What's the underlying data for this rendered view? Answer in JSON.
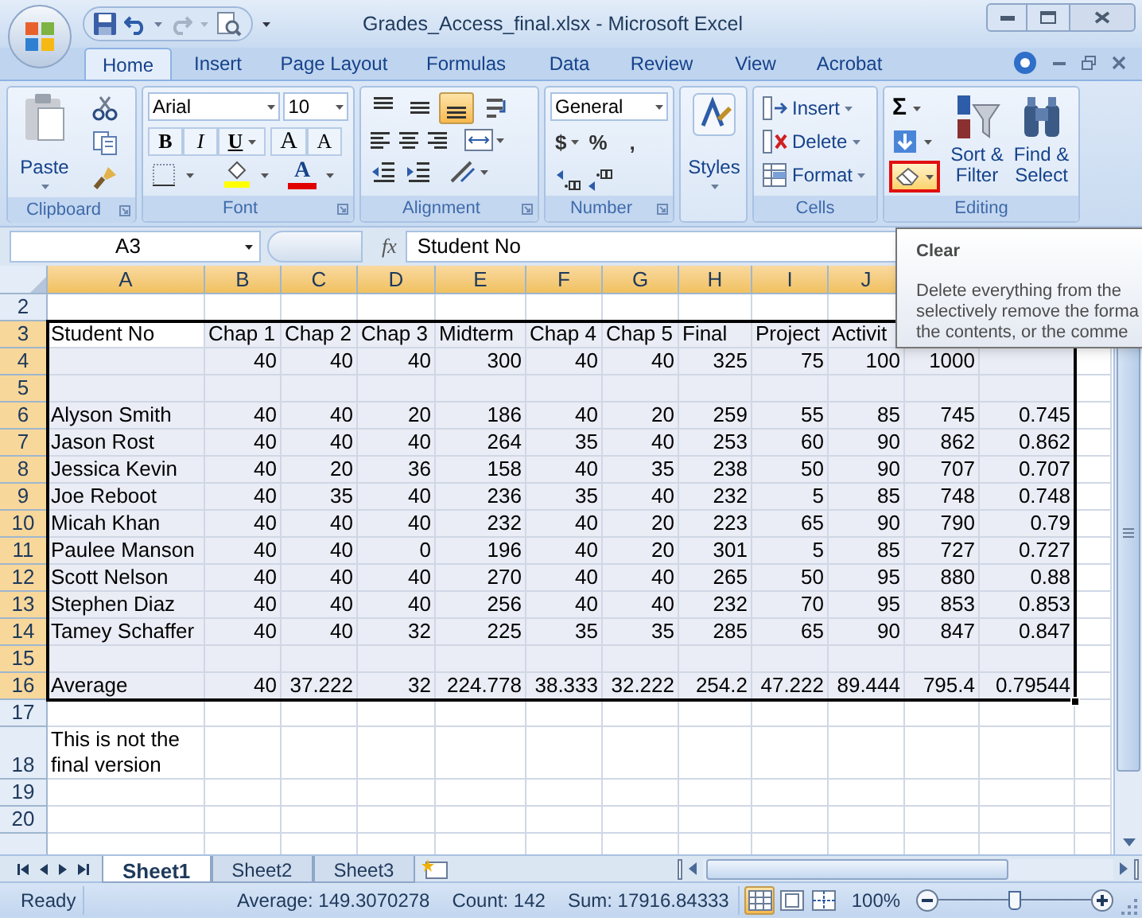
{
  "title_bar": {
    "title": "Grades_Access_final.xlsx - Microsoft Excel"
  },
  "tabs": [
    {
      "label": "Home",
      "selected": true
    },
    {
      "label": "Insert",
      "selected": false
    },
    {
      "label": "Page Layout",
      "selected": false
    },
    {
      "label": "Formulas",
      "selected": false
    },
    {
      "label": "Data",
      "selected": false
    },
    {
      "label": "Review",
      "selected": false
    },
    {
      "label": "View",
      "selected": false
    },
    {
      "label": "Acrobat",
      "selected": false
    }
  ],
  "ribbon": {
    "clipboard": {
      "paste": "Paste",
      "label": "Clipboard"
    },
    "font": {
      "name": "Arial",
      "size": "10",
      "bold": "B",
      "italic": "I",
      "underline": "U",
      "grow": "A",
      "shrink": "A",
      "font_color": "A",
      "label": "Font"
    },
    "alignment": {
      "vertical": [
        {
          "kind": "top",
          "selected": false
        },
        {
          "kind": "middle",
          "selected": false
        },
        {
          "kind": "bottom",
          "selected": true
        }
      ],
      "label": "Alignment"
    },
    "number": {
      "format": "General",
      "currency": "$",
      "percent": "%",
      "comma": ",",
      "label": "Number"
    },
    "styles": {
      "label": "Styles"
    },
    "cells": {
      "insert": "Insert",
      "delete": "Delete",
      "format": "Format",
      "label": "Cells"
    },
    "editing": {
      "sum": "Σ",
      "sort": "Sort &\nFilter",
      "find": "Find &\nSelect",
      "clear_highlighted": true,
      "label": "Editing"
    }
  },
  "formula_bar": {
    "name_box": "A3",
    "function_label": "fx",
    "formula": "Student No"
  },
  "columns": [
    {
      "label": "A",
      "selected": true
    },
    {
      "label": "B",
      "selected": true
    },
    {
      "label": "C",
      "selected": true
    },
    {
      "label": "D",
      "selected": true
    },
    {
      "label": "E",
      "selected": true
    },
    {
      "label": "F",
      "selected": true
    },
    {
      "label": "G",
      "selected": true
    },
    {
      "label": "H",
      "selected": true
    },
    {
      "label": "I",
      "selected": true
    },
    {
      "label": "J",
      "selected": true
    }
  ],
  "rows": [
    {
      "number": "2",
      "kind": "data",
      "selected": false,
      "cells": []
    },
    {
      "number": "3",
      "kind": "header",
      "selected": true,
      "cells": [
        "Student No",
        "Chap 1",
        "Chap 2",
        "Chap 3",
        "Midterm",
        "Chap 4",
        "Chap 5",
        "Final",
        "Project",
        "Activit"
      ]
    },
    {
      "number": "4",
      "kind": "data",
      "selected": true,
      "cells": [
        null,
        "40",
        "40",
        "40",
        "300",
        "40",
        "40",
        "325",
        "75",
        "100",
        "1000"
      ]
    },
    {
      "number": "5",
      "kind": "data",
      "selected": true,
      "cells": []
    },
    {
      "number": "6",
      "kind": "data",
      "selected": true,
      "cells": [
        "Alyson Smith",
        "40",
        "40",
        "20",
        "186",
        "40",
        "20",
        "259",
        "55",
        "85",
        "745",
        "0.745"
      ]
    },
    {
      "number": "7",
      "kind": "data",
      "selected": true,
      "cells": [
        "Jason Rost",
        "40",
        "40",
        "40",
        "264",
        "35",
        "40",
        "253",
        "60",
        "90",
        "862",
        "0.862"
      ]
    },
    {
      "number": "8",
      "kind": "data",
      "selected": true,
      "cells": [
        "Jessica Kevin",
        "40",
        "20",
        "36",
        "158",
        "40",
        "35",
        "238",
        "50",
        "90",
        "707",
        "0.707"
      ]
    },
    {
      "number": "9",
      "kind": "data",
      "selected": true,
      "cells": [
        "Joe Reboot",
        "40",
        "35",
        "40",
        "236",
        "35",
        "40",
        "232",
        "5",
        "85",
        "748",
        "0.748"
      ]
    },
    {
      "number": "10",
      "kind": "data",
      "selected": true,
      "cells": [
        "Micah Khan",
        "40",
        "40",
        "40",
        "232",
        "40",
        "20",
        "223",
        "65",
        "90",
        "790",
        "0.79"
      ]
    },
    {
      "number": "11",
      "kind": "data",
      "selected": true,
      "cells": [
        "Paulee Manson",
        "40",
        "40",
        "0",
        "196",
        "40",
        "20",
        "301",
        "5",
        "85",
        "727",
        "0.727"
      ]
    },
    {
      "number": "12",
      "kind": "data",
      "selected": true,
      "cells": [
        "Scott Nelson",
        "40",
        "40",
        "40",
        "270",
        "40",
        "40",
        "265",
        "50",
        "95",
        "880",
        "0.88"
      ]
    },
    {
      "number": "13",
      "kind": "data",
      "selected": true,
      "cells": [
        "Stephen Diaz",
        "40",
        "40",
        "40",
        "256",
        "40",
        "40",
        "232",
        "70",
        "95",
        "853",
        "0.853"
      ]
    },
    {
      "number": "14",
      "kind": "data",
      "selected": true,
      "cells": [
        "Tamey Schaffer",
        "40",
        "40",
        "32",
        "225",
        "35",
        "35",
        "285",
        "65",
        "90",
        "847",
        "0.847"
      ]
    },
    {
      "number": "15",
      "kind": "data",
      "selected": true,
      "cells": []
    },
    {
      "number": "16",
      "kind": "data",
      "selected": true,
      "cells": [
        "Average",
        "40",
        "37.222",
        "32",
        "224.778",
        "38.333",
        "32.222",
        "254.2",
        "47.222",
        "89.444",
        "795.4",
        "0.79544"
      ]
    },
    {
      "number": "17",
      "kind": "data",
      "selected": false,
      "cells": []
    },
    {
      "number": "18",
      "kind": "data",
      "selected": false,
      "cells": [
        "This is not the final version"
      ]
    },
    {
      "number": "19",
      "kind": "data",
      "selected": false,
      "cells": []
    },
    {
      "number": "20",
      "kind": "data",
      "selected": false,
      "cells": []
    }
  ],
  "tooltip": {
    "title": "Clear",
    "body": "Delete everything from the\nselectively remove the forma\nthe contents, or the comme"
  },
  "sheet_tabs": [
    {
      "label": "Sheet1",
      "selected": true
    },
    {
      "label": "Sheet2",
      "selected": false
    },
    {
      "label": "Sheet3",
      "selected": false
    }
  ],
  "status_bar": {
    "mode": "Ready",
    "average": "Average: 149.3070278",
    "count": "Count: 142",
    "sum": "Sum: 17916.84333",
    "views": [
      {
        "kind": "normal",
        "selected": true
      },
      {
        "kind": "page_layout",
        "selected": false
      },
      {
        "kind": "page_break",
        "selected": false
      }
    ],
    "zoom": "100%",
    "zoom_slider": {
      "level": 0.5
    }
  }
}
